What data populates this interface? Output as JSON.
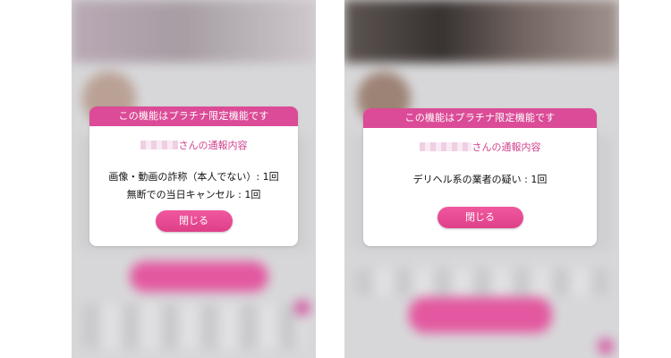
{
  "panels": [
    {
      "modal": {
        "header": "この機能はプラチナ限定機能です",
        "report_suffix": "さんの通報内容",
        "report_lines": [
          "画像・動画の詐称（本人でない）: 1回",
          "無断での当日キャンセル : 1回"
        ],
        "close_label": "閉じる"
      }
    },
    {
      "modal": {
        "header": "この機能はプラチナ限定機能です",
        "report_suffix": "さんの通報内容",
        "report_lines": [
          "デリヘル系の業者の疑い : 1回"
        ],
        "close_label": "閉じる"
      }
    }
  ],
  "colors": {
    "accent": "#db4b97",
    "accent_text": "#d1438d",
    "button_gradient_top": "#f0589f",
    "button_gradient_bottom": "#de3f88"
  }
}
